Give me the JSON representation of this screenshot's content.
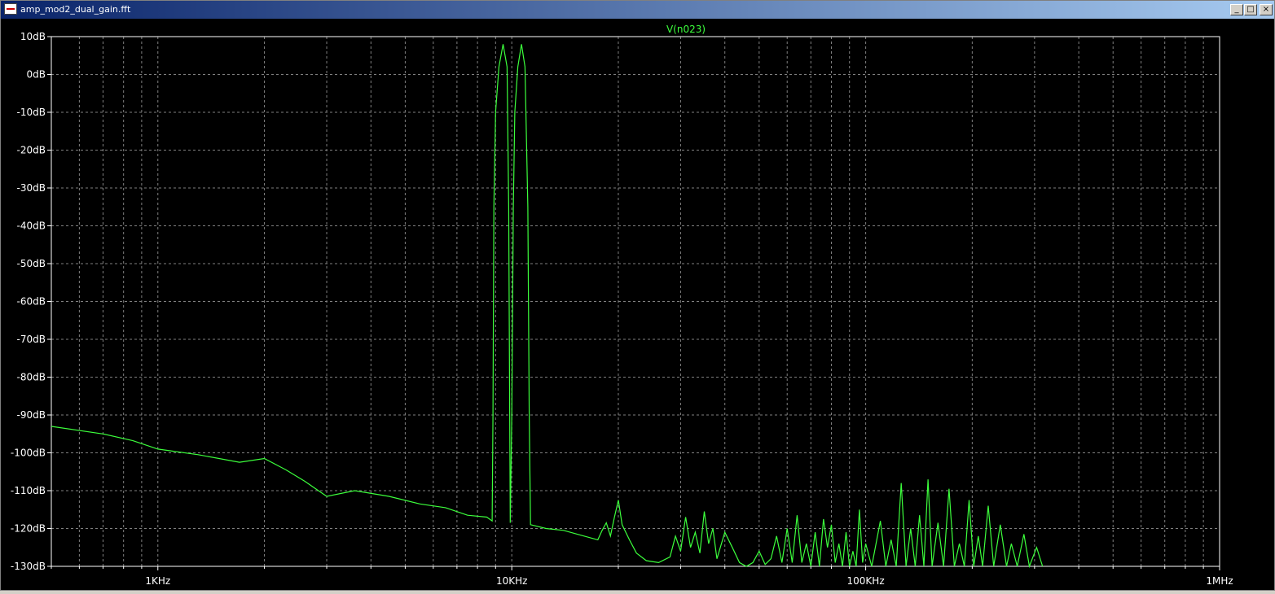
{
  "window": {
    "title": "amp_mod2_dual_gain.fft",
    "buttons": {
      "minimize": "_",
      "maximize": "□",
      "close": "×"
    }
  },
  "colors": {
    "trace": "#3cff3c",
    "grid": "#808080",
    "axis": "#ffffff",
    "background": "#000000"
  },
  "chart_data": {
    "type": "line",
    "title": "V(n023)",
    "xlabel": "",
    "ylabel": "",
    "xscale": "log",
    "xlim": [
      500,
      1000000
    ],
    "ylim": [
      -130,
      10
    ],
    "grid": true,
    "x_ticks": [
      {
        "value": 1000,
        "label": "1KHz"
      },
      {
        "value": 10000,
        "label": "10KHz"
      },
      {
        "value": 100000,
        "label": "100KHz"
      },
      {
        "value": 1000000,
        "label": "1MHz"
      }
    ],
    "y_ticks": [
      {
        "value": 10,
        "label": "10dB"
      },
      {
        "value": 0,
        "label": "0dB"
      },
      {
        "value": -10,
        "label": "-10dB"
      },
      {
        "value": -20,
        "label": "-20dB"
      },
      {
        "value": -30,
        "label": "-30dB"
      },
      {
        "value": -40,
        "label": "-40dB"
      },
      {
        "value": -50,
        "label": "-50dB"
      },
      {
        "value": -60,
        "label": "-60dB"
      },
      {
        "value": -70,
        "label": "-70dB"
      },
      {
        "value": -80,
        "label": "-80dB"
      },
      {
        "value": -90,
        "label": "-90dB"
      },
      {
        "value": -100,
        "label": "-100dB"
      },
      {
        "value": -110,
        "label": "-110dB"
      },
      {
        "value": -120,
        "label": "-120dB"
      },
      {
        "value": -130,
        "label": "-130dB"
      }
    ],
    "series": [
      {
        "name": "V(n023)",
        "points": [
          [
            500,
            -93
          ],
          [
            700,
            -95
          ],
          [
            850,
            -96.8
          ],
          [
            1000,
            -99
          ],
          [
            1300,
            -100.5
          ],
          [
            1700,
            -102.5
          ],
          [
            2000,
            -101.5
          ],
          [
            2300,
            -104.5
          ],
          [
            2600,
            -107.5
          ],
          [
            3000,
            -111.5
          ],
          [
            3600,
            -110
          ],
          [
            4500,
            -111.5
          ],
          [
            5500,
            -113.5
          ],
          [
            6500,
            -114.5
          ],
          [
            7500,
            -116.5
          ],
          [
            8500,
            -117
          ],
          [
            8800,
            -118
          ],
          [
            8850,
            -90
          ],
          [
            8900,
            -35
          ],
          [
            9000,
            -10
          ],
          [
            9200,
            2
          ],
          [
            9450,
            8
          ],
          [
            9700,
            2
          ],
          [
            9800,
            -35
          ],
          [
            9900,
            -118.5
          ],
          [
            10000,
            -90
          ],
          [
            10100,
            -35
          ],
          [
            10200,
            -10
          ],
          [
            10400,
            2
          ],
          [
            10650,
            8
          ],
          [
            10900,
            2
          ],
          [
            11100,
            -35
          ],
          [
            11200,
            -90
          ],
          [
            11300,
            -119
          ],
          [
            12500,
            -120
          ],
          [
            14000,
            -120.5
          ],
          [
            16000,
            -122
          ],
          [
            17500,
            -123
          ],
          [
            18000,
            -120.5
          ],
          [
            18500,
            -118.5
          ],
          [
            19000,
            -122
          ],
          [
            19500,
            -117
          ],
          [
            20000,
            -112.5
          ],
          [
            20500,
            -119
          ],
          [
            21500,
            -123
          ],
          [
            22500,
            -126.5
          ],
          [
            24000,
            -128.5
          ],
          [
            26000,
            -129
          ],
          [
            28000,
            -127.5
          ],
          [
            29000,
            -122
          ],
          [
            30000,
            -126
          ],
          [
            31000,
            -117
          ],
          [
            32000,
            -125
          ],
          [
            33000,
            -121
          ],
          [
            34000,
            -126.5
          ],
          [
            35000,
            -115.5
          ],
          [
            36000,
            -124
          ],
          [
            37000,
            -120
          ],
          [
            38000,
            -128
          ],
          [
            40000,
            -121
          ],
          [
            42000,
            -125
          ],
          [
            44000,
            -129
          ],
          [
            46000,
            -130
          ],
          [
            48000,
            -129
          ],
          [
            50000,
            -126
          ],
          [
            52000,
            -129.5
          ],
          [
            54000,
            -128
          ],
          [
            56000,
            -122
          ],
          [
            58000,
            -129
          ],
          [
            60000,
            -120
          ],
          [
            62000,
            -129
          ],
          [
            64000,
            -116.5
          ],
          [
            66000,
            -129
          ],
          [
            68000,
            -124
          ],
          [
            70000,
            -130
          ],
          [
            72000,
            -121
          ],
          [
            74000,
            -130
          ],
          [
            76000,
            -117.5
          ],
          [
            78000,
            -125
          ],
          [
            80000,
            -119
          ],
          [
            82000,
            -129
          ],
          [
            84000,
            -124
          ],
          [
            86000,
            -130
          ],
          [
            88000,
            -121
          ],
          [
            90000,
            -130
          ],
          [
            92000,
            -126
          ],
          [
            94000,
            -130
          ],
          [
            96000,
            -115
          ],
          [
            98000,
            -129
          ],
          [
            100000,
            -124
          ],
          [
            104000,
            -130
          ],
          [
            110000,
            -118
          ],
          [
            114000,
            -130
          ],
          [
            118000,
            -123
          ],
          [
            122000,
            -130
          ],
          [
            126000,
            -108
          ],
          [
            130000,
            -130
          ],
          [
            134000,
            -120
          ],
          [
            138000,
            -130
          ],
          [
            142000,
            -116.5
          ],
          [
            146000,
            -130
          ],
          [
            150000,
            -107
          ],
          [
            154000,
            -130
          ],
          [
            160000,
            -118.5
          ],
          [
            166000,
            -130
          ],
          [
            172000,
            -109.5
          ],
          [
            178000,
            -130
          ],
          [
            184000,
            -124
          ],
          [
            190000,
            -130
          ],
          [
            196000,
            -112.5
          ],
          [
            202000,
            -130
          ],
          [
            208000,
            -122
          ],
          [
            214000,
            -130
          ],
          [
            222000,
            -114
          ],
          [
            230000,
            -130
          ],
          [
            240000,
            -119
          ],
          [
            250000,
            -130
          ],
          [
            258000,
            -124
          ],
          [
            268000,
            -130
          ],
          [
            280000,
            -121.5
          ],
          [
            290000,
            -130
          ],
          [
            304000,
            -125
          ],
          [
            316000,
            -130
          ]
        ]
      }
    ]
  }
}
